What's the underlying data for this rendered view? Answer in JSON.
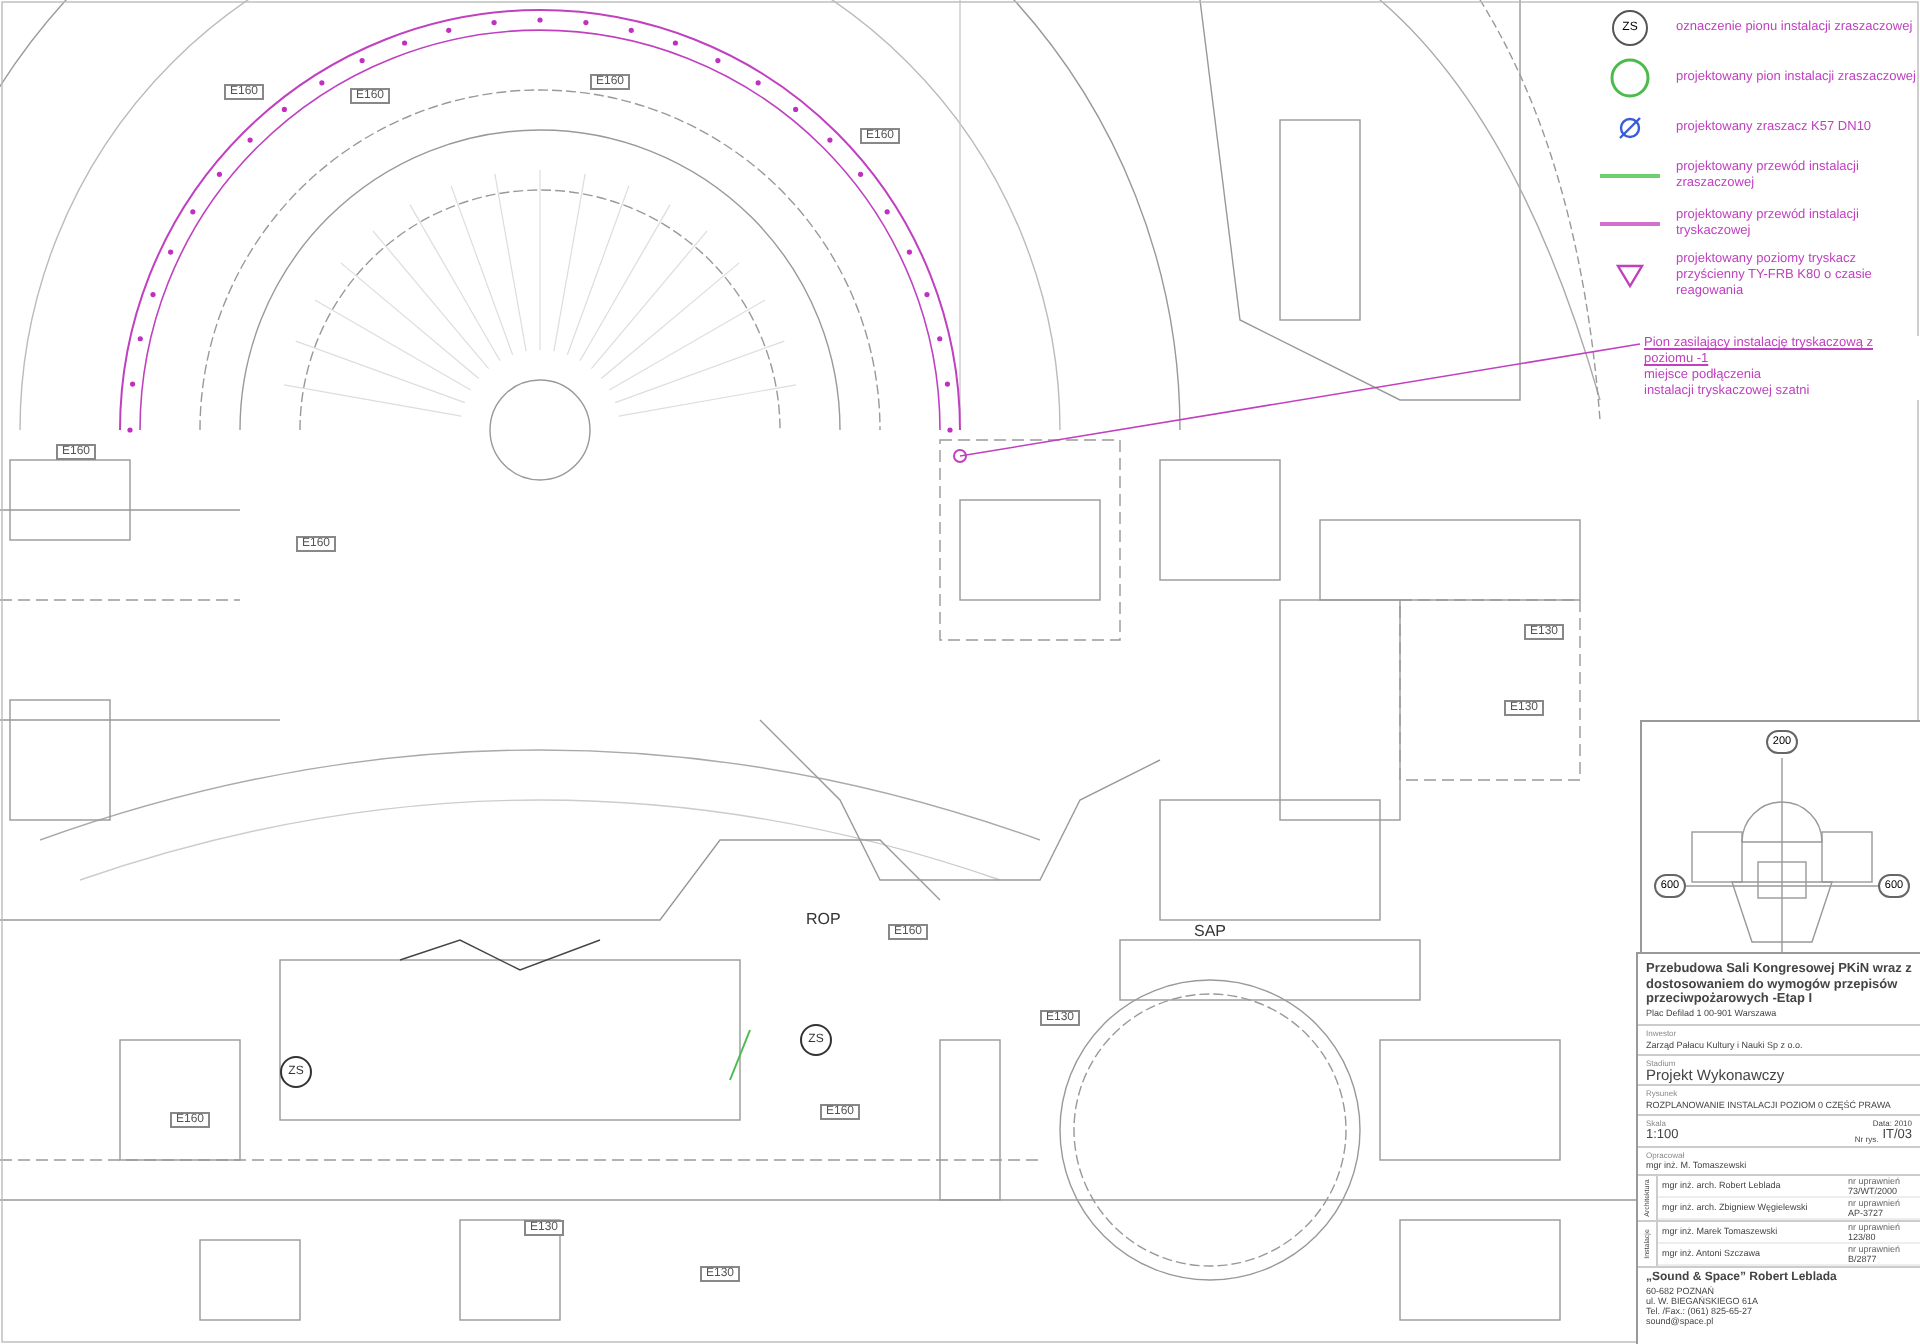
{
  "legend": [
    {
      "kind": "zs",
      "symbol": "ZS",
      "text": "oznaczenie pionu instalacji zraszaczowej"
    },
    {
      "kind": "riser",
      "text": "projektowany pion instalacji zraszaczowej"
    },
    {
      "kind": "sprinkler",
      "text": "projektowany zraszacz K57 DN10"
    },
    {
      "kind": "green-line",
      "text": "projektowany przewód instalacji zraszaczowej"
    },
    {
      "kind": "magenta-line",
      "text": "projektowany przewód instalacji tryskaczowej"
    },
    {
      "kind": "wall-sprinkler",
      "text": "projektowany poziomy tryskacz przyścienny TY-FRB K80 o czasie reagowania"
    }
  ],
  "note": [
    "Pion zasilający instalację tryskaczową z poziomu -1",
    "miejsce podłączenia",
    "instalacji tryskaczowej szatni"
  ],
  "plan_labels": [
    {
      "kind": "door",
      "text": "E160"
    },
    {
      "kind": "door",
      "text": "E160"
    },
    {
      "kind": "door",
      "text": "E160"
    },
    {
      "kind": "door",
      "text": "E160"
    },
    {
      "kind": "door",
      "text": "E160"
    },
    {
      "kind": "door",
      "text": "E160"
    },
    {
      "kind": "door",
      "text": "E130"
    },
    {
      "kind": "door",
      "text": "E130"
    },
    {
      "kind": "door",
      "text": "E160"
    },
    {
      "kind": "door",
      "text": "E130"
    },
    {
      "kind": "door",
      "text": "E160"
    },
    {
      "kind": "door",
      "text": "E130"
    },
    {
      "kind": "door",
      "text": "E130"
    },
    {
      "kind": "door",
      "text": "E160"
    },
    {
      "kind": "plain",
      "text": "ROP"
    },
    {
      "kind": "riser",
      "text": "ZS"
    },
    {
      "kind": "riser",
      "text": "ZS"
    },
    {
      "kind": "plain",
      "text": "SAP"
    }
  ],
  "key_plan": [
    "200",
    "600",
    "600"
  ],
  "title_block": {
    "project": "Przebudowa Sali Kongresowej PKiN wraz z dostosowaniem do wymogów przepisów przeciwpożarowych  -Etap I",
    "address": "Plac Defilad 1 00-901 Warszawa",
    "investor_label": "Inwestor",
    "investor": "Zarząd Pałacu Kultury i Nauki Sp z o.o.",
    "stage_label": "Stadium",
    "stage": "Projekt Wykonawczy",
    "drawing_label": "Rysunek",
    "drawing": "ROZPLANOWANIE INSTALACJI POZIOM 0 CZĘŚĆ PRAWA",
    "scale_label": "Skala",
    "scale": "1:100",
    "date": "Data: 2010",
    "number_label": "Nr rys.",
    "number": "IT/03",
    "author_label": "Opracował",
    "author": "mgr inż. M. Tomaszewski",
    "groups": [
      {
        "label": "Architektura",
        "rows": [
          {
            "name": "mgr inż. arch. Robert Leblada",
            "permit_label": "nr uprawnień",
            "permit": "73/WT/2000"
          },
          {
            "name": "mgr inż. arch. Zbigniew Węgielewski",
            "permit_label": "nr uprawnień",
            "permit": "AP-3727"
          }
        ]
      },
      {
        "label": "Instalacje",
        "rows": [
          {
            "name": "mgr inż. Marek Tomaszewski",
            "permit_label": "nr uprawnień",
            "permit": "123/80"
          },
          {
            "name": "mgr inż. Antoni Szczawa",
            "permit_label": "nr uprawnień",
            "permit": "B/2877"
          }
        ]
      }
    ],
    "company": [
      "„Sound & Space” Robert Leblada",
      "60-682 POZNAŃ",
      "ul. W. BIEGAŃSKIEGO 61A",
      "Tel. /Fax.: (061) 825-65-27",
      "sound@space.pl"
    ]
  }
}
